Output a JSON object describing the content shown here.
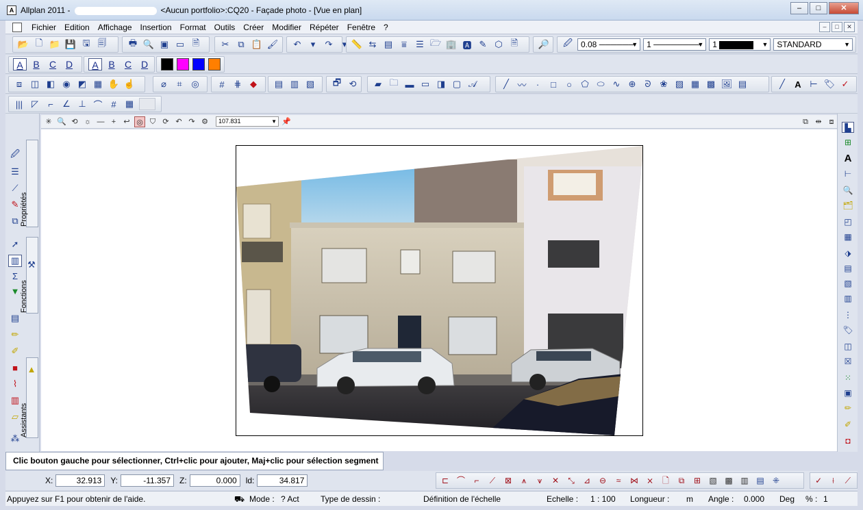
{
  "window": {
    "app": "Allplan 2011 -",
    "document": "<Aucun portfolio>:CQ20 - Façade photo - [Vue en plan]",
    "buttons": [
      "–",
      "□",
      "✕"
    ]
  },
  "menu": {
    "items": [
      "Fichier",
      "Edition",
      "Affichage",
      "Insertion",
      "Format",
      "Outils",
      "Créer",
      "Modifier",
      "Répéter",
      "Fenêtre",
      "?"
    ],
    "mdi_buttons": [
      "–",
      "□",
      "✕"
    ]
  },
  "toolbar": {
    "pen_value": "0.08",
    "line_value": "1",
    "color_value": "1",
    "layer_value": "STANDARD",
    "letters_a": [
      "A",
      "B",
      "C",
      "D"
    ],
    "letters_b": [
      "A",
      "B",
      "C",
      "D"
    ],
    "swatches": [
      "#000000",
      "#ff00ff",
      "#0000ff",
      "#ff7f00"
    ]
  },
  "view": {
    "zoom": "107.831"
  },
  "left_tabs": {
    "properties": "Propriétés",
    "functions": "Fonctions",
    "assistants": "Assistants"
  },
  "right_bar": {
    "text_icon": "A"
  },
  "hint": "Clic bouton gauche pour sélectionner, Ctrl+clic pour ajouter, Maj+clic pour sélection segment",
  "coords": {
    "x_label": "X:",
    "x": "32.913",
    "y_label": "Y:",
    "y": "-11.357",
    "z_label": "Z:",
    "z": "0.000",
    "d_label": "ld:",
    "d": "34.817"
  },
  "status": {
    "help": "Appuyez sur F1 pour obtenir de l'aide.",
    "mode_label": "Mode :",
    "mode_value": "? Act",
    "drawing_type_label": "Type de dessin :",
    "scale_def": "Définition de l'échelle",
    "scale_label": "Echelle :",
    "scale_value": "1 : 100",
    "length_label": "Longueur :",
    "length_unit": "m",
    "angle_label": "Angle :",
    "angle_value": "0.000",
    "angle_unit": "Deg",
    "percent_label": "% :",
    "percent_value": "1"
  }
}
